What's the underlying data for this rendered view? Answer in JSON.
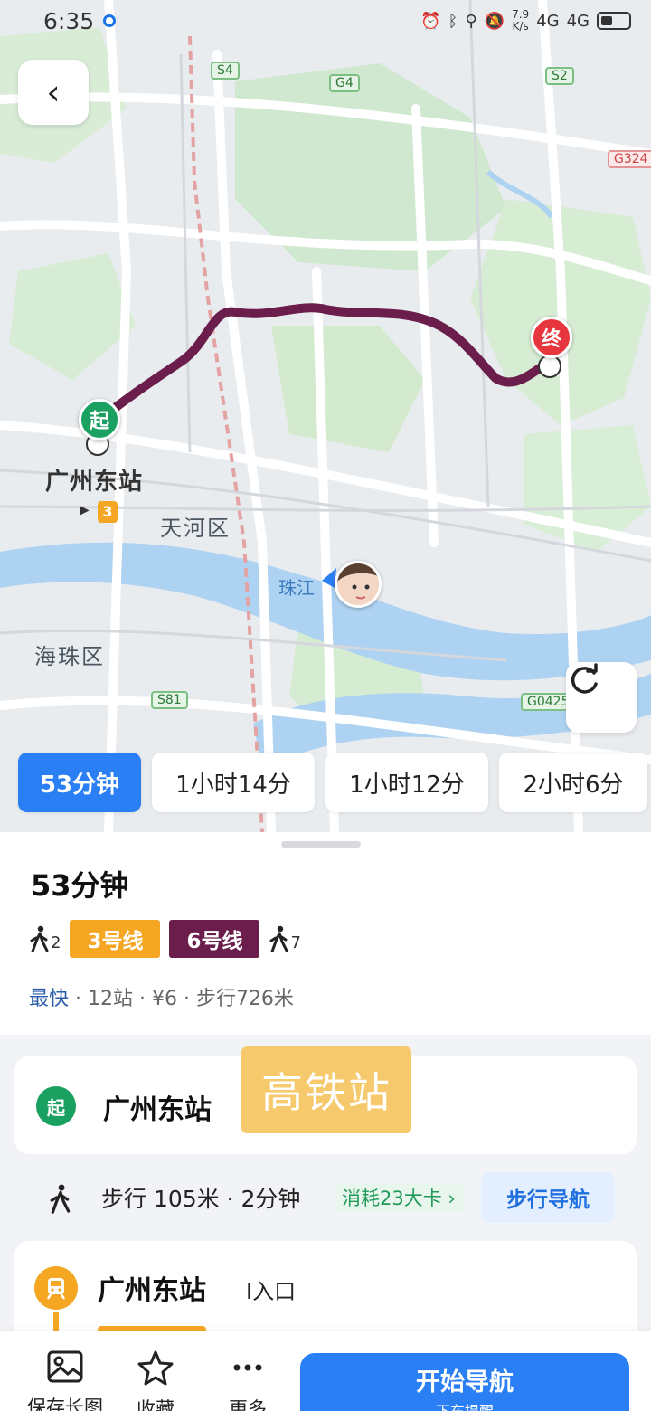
{
  "status": {
    "time": "6:35",
    "speed": "7.9",
    "speed_unit": "K/s",
    "net1": "4G",
    "net2": "4G"
  },
  "map": {
    "labels": {
      "start_station": "广州东站",
      "tianhe": "天河区",
      "haizhu": "海珠区",
      "pearl_river": "珠江",
      "line3": "3"
    },
    "road_tags": {
      "s4": "S4",
      "g4": "G4",
      "s2": "S2",
      "g324": "G324",
      "s81": "S81",
      "g0425": "G0425"
    },
    "pins": {
      "start": "起",
      "end": "终"
    },
    "route_color": "#6b1e4c"
  },
  "tabs": [
    "53分钟",
    "1小时14分",
    "1小时12分",
    "2小时6分"
  ],
  "summary": {
    "duration": "53分钟",
    "walk1": "2",
    "line_a": {
      "label": "3号线",
      "color": "#f5a623"
    },
    "line_b": {
      "label": "6号线",
      "color": "#6b1e4c"
    },
    "walk2": "7",
    "tag": "最快",
    "detail": " · 12站 · ¥6 · 步行726米"
  },
  "steps": {
    "start_badge": "起",
    "start_name": "广州东站",
    "hsr_label": "高铁站",
    "walk_text": "步行 105米 · 2分钟",
    "calorie": "消耗23大卡 ›",
    "walk_nav": "步行导航",
    "metro_station": "广州东站",
    "entrance": "I入口"
  },
  "bottom": {
    "save_image": "保存长图",
    "favorite": "收藏",
    "more": "更多",
    "start_nav": "开始导航",
    "alight_reminder": "下车提醒"
  }
}
